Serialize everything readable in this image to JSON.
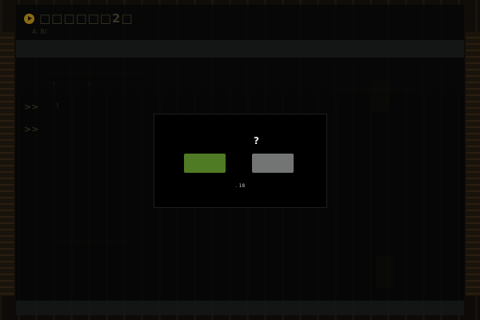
{
  "header": {
    "title": "□□□□□□2□",
    "subtitle": "A. B/ ."
  },
  "log": {
    "prompt_1": ">>",
    "prompt_2": ">>",
    "tick_a": "'",
    "tick_b": ":",
    "tick_c": "!"
  },
  "dialog": {
    "question": "?",
    "yes_label": "",
    "no_label": "",
    "counter": ". 18"
  },
  "colors": {
    "accent": "#8a6a12",
    "confirm": "#507b25",
    "cancel": "#737574"
  },
  "icons": {
    "title_icon": "play-circle-icon"
  }
}
